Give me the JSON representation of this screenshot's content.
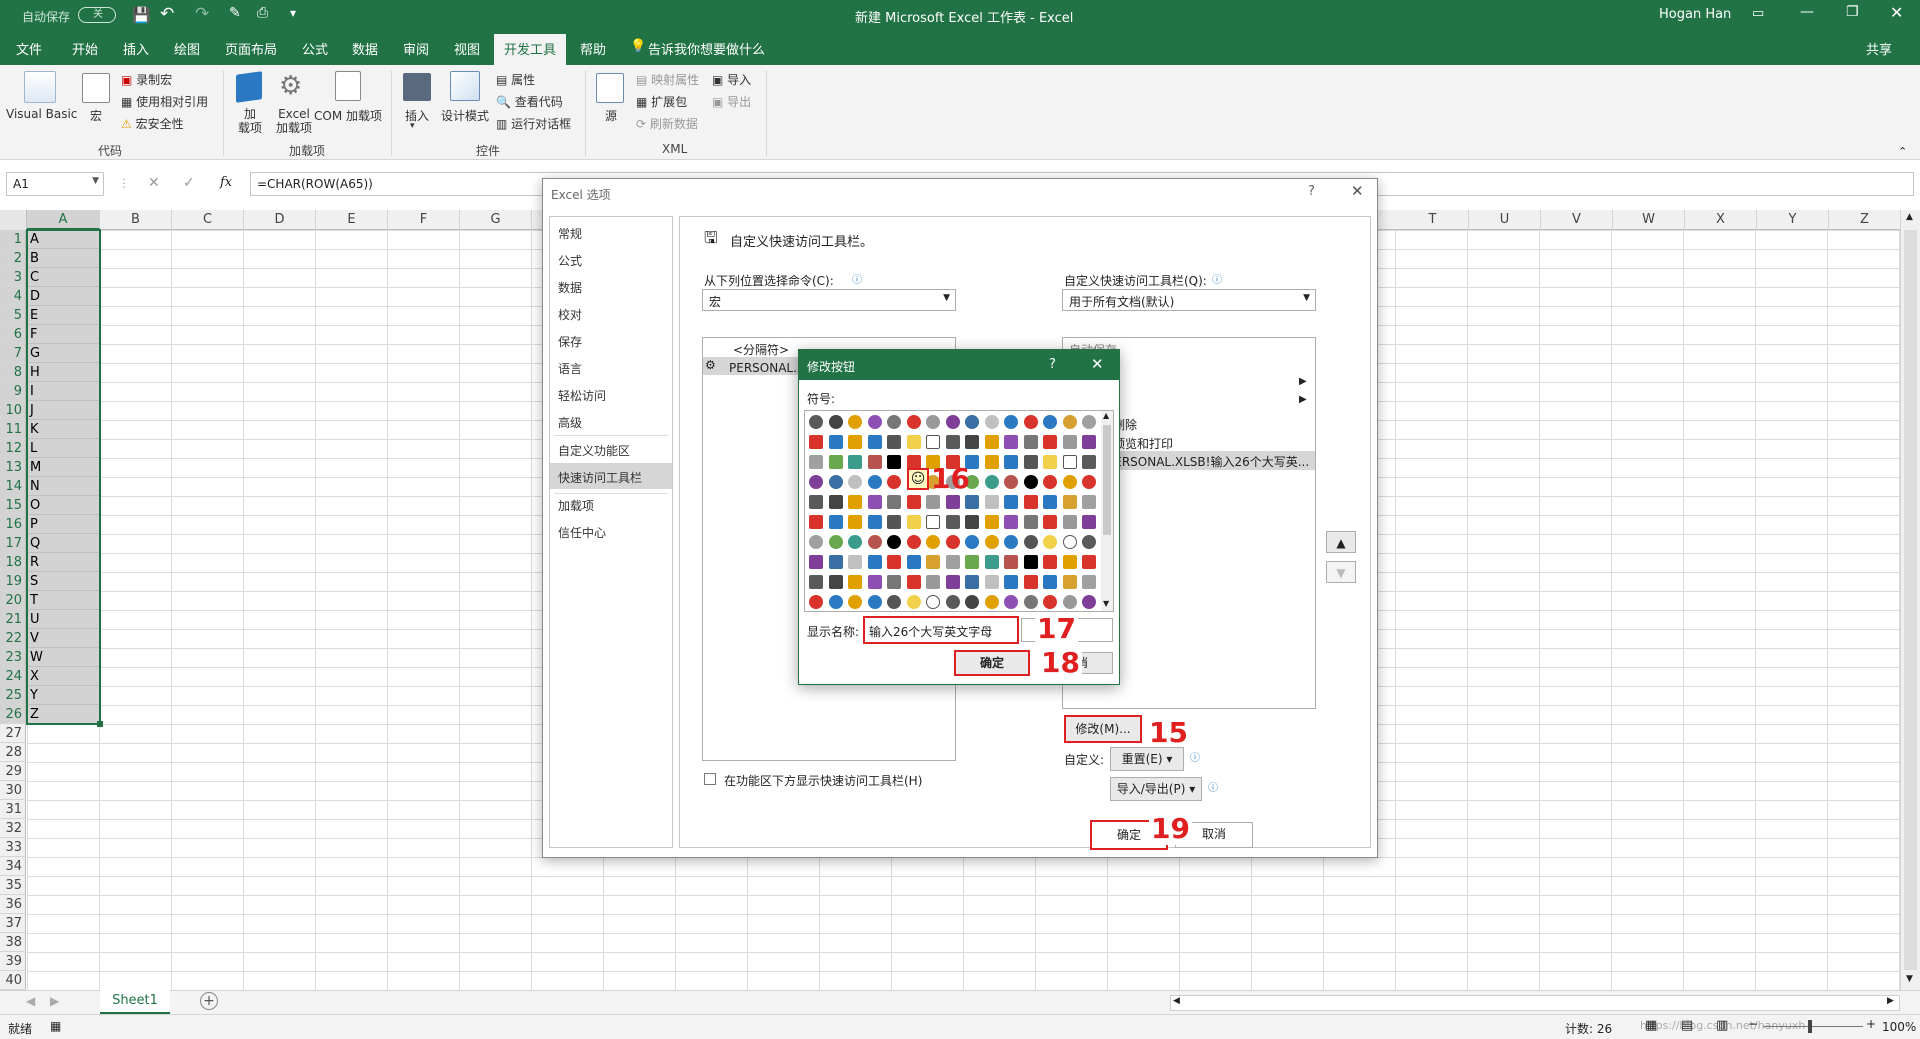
{
  "titlebar": {
    "autosave_label": "自动保存",
    "autosave_state": "关",
    "title": "新建 Microsoft Excel 工作表  -  Excel",
    "user": "Hogan Han",
    "share_label": "共享"
  },
  "tabs": [
    "文件",
    "开始",
    "插入",
    "绘图",
    "页面布局",
    "公式",
    "数据",
    "审阅",
    "视图",
    "开发工具",
    "帮助"
  ],
  "tell_me": "告诉我你想要做什么",
  "ribbon": {
    "code": {
      "name": "代码",
      "visual_basic": "Visual Basic",
      "macro": "宏",
      "record": "录制宏",
      "relative": "使用相对引用",
      "security": "宏安全性"
    },
    "addins": {
      "name": "加载项",
      "addin": "加\n载项",
      "excel_addin": "Excel\n加载项",
      "com_addin": "COM 加载项"
    },
    "controls": {
      "name": "控件",
      "insert": "插入",
      "design": "设计模式",
      "properties": "属性",
      "view_code": "查看代码",
      "run_dialog": "运行对话框"
    },
    "xml": {
      "name": "XML",
      "source": "源",
      "map_props": "映射属性",
      "expansion": "扩展包",
      "refresh": "刷新数据",
      "import": "导入",
      "export": "导出"
    }
  },
  "formula": {
    "name_box": "A1",
    "fx": "fx",
    "formula": "=CHAR(ROW(A65))"
  },
  "columns_left": [
    "A",
    "B",
    "C",
    "D",
    "E",
    "F",
    "G"
  ],
  "columns_right": [
    "T",
    "U",
    "V",
    "W",
    "X",
    "Y",
    "Z"
  ],
  "rows": [
    "1",
    "2",
    "3",
    "4",
    "5",
    "6",
    "7",
    "8",
    "9",
    "10",
    "11",
    "12",
    "13",
    "14",
    "15",
    "16",
    "17",
    "18",
    "19",
    "20",
    "21",
    "22",
    "23",
    "24",
    "25",
    "26",
    "27",
    "28",
    "29",
    "30",
    "31",
    "32",
    "33",
    "34",
    "35",
    "36",
    "37",
    "38",
    "39",
    "40"
  ],
  "cells_a": [
    "A",
    "B",
    "C",
    "D",
    "E",
    "F",
    "G",
    "H",
    "I",
    "J",
    "K",
    "L",
    "M",
    "N",
    "O",
    "P",
    "Q",
    "R",
    "S",
    "T",
    "U",
    "V",
    "W",
    "X",
    "Y",
    "Z"
  ],
  "sheet_tab": "Sheet1",
  "status": {
    "ready": "就绪",
    "count": "计数: 26",
    "zoom": "100%",
    "watermark": "https://blog.csdn.net/hanyuxh"
  },
  "options_dialog": {
    "title": "Excel 选项",
    "help": "?",
    "nav": [
      "常规",
      "公式",
      "数据",
      "校对",
      "保存",
      "语言",
      "轻松访问",
      "高级",
      "自定义功能区",
      "快速访问工具栏",
      "加载项",
      "信任中心"
    ],
    "nav_selected": "快速访问工具栏",
    "heading": "自定义快速访问工具栏。",
    "choose_from_label": "从下列位置选择命令(C):",
    "choose_from_value": "宏",
    "customize_label": "自定义快速访问工具栏(Q):",
    "customize_value": "用于所有文档(默认)",
    "left_list": [
      "<分隔符>",
      "PERSONAL.XLSB!输入26个大写英文字母"
    ],
    "right_list": [
      "自动保存",
      "",
      "",
      "删除",
      "预览和打印",
      "PERSONAL.XLSB!输入26个大写英..."
    ],
    "modify_button": "修改(M)...",
    "custom_label": "自定义:",
    "reset_button": "重置(E) ▾",
    "import_export_button": "导入/导出(P) ▾",
    "show_below": "在功能区下方显示快速访问工具栏(H)",
    "ok": "确定",
    "cancel": "取消"
  },
  "modify_dialog": {
    "title": "修改按钮",
    "help": "?",
    "symbol_label": "符号:",
    "display_name_label": "显示名称:",
    "display_name_value": "输入26个大写英文字母",
    "ok": "确定",
    "cancel": "取消"
  },
  "annotations": [
    "15",
    "16",
    "17",
    "18",
    "19"
  ],
  "colors": {
    "excel_green": "#217346",
    "annotation_red": "#e02020",
    "selection_gray": "#d3d3d3"
  }
}
